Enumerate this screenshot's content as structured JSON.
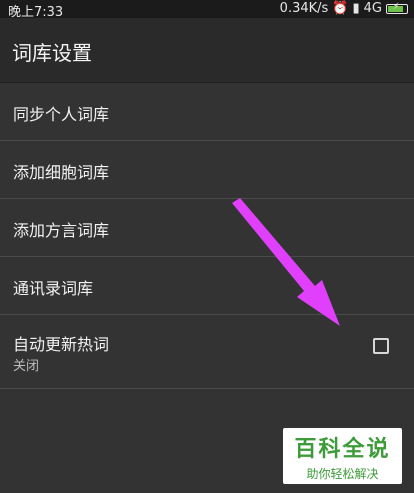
{
  "status_bar": {
    "time": "晚上7:33",
    "speed": "0.34K/s",
    "alarm_icon": "alarm-icon",
    "signal": "4G",
    "battery_fill": 0.85,
    "battery_color": "#6ec14a"
  },
  "header": {
    "title": "词库设置"
  },
  "settings": {
    "items": [
      {
        "label": "同步个人词库"
      },
      {
        "label": "添加细胞词库"
      },
      {
        "label": "添加方言词库"
      },
      {
        "label": "通讯录词库"
      },
      {
        "label": "自动更新热词",
        "sub": "关闭",
        "checked": false
      }
    ]
  },
  "annotation": {
    "arrow_color": "#e040fb"
  },
  "watermark": {
    "title": "百科全说",
    "subtitle": "助你轻松解决",
    "color": "#3d9b3a"
  }
}
